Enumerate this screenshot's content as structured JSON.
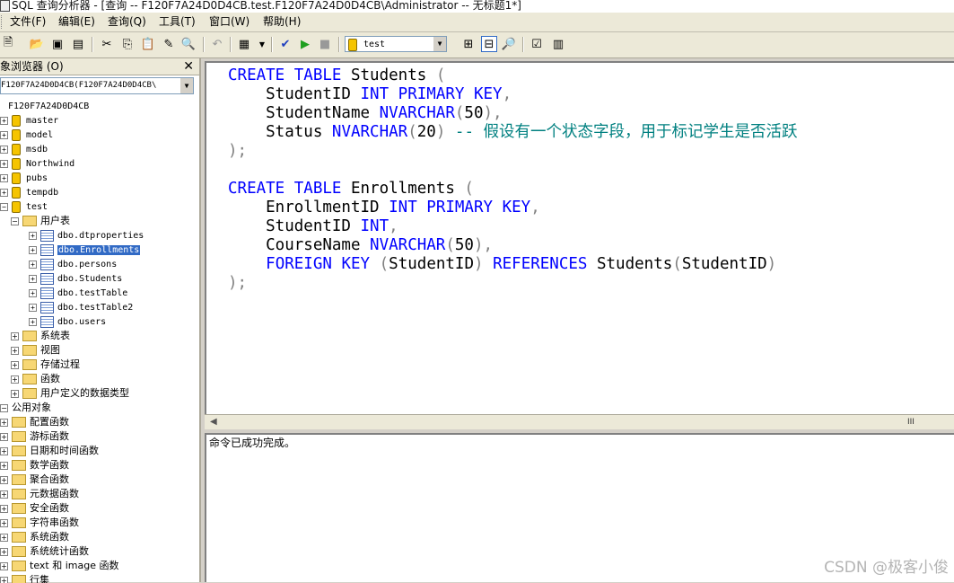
{
  "window": {
    "title": "SQL 查询分析器 - [查询 -- F120F7A24D0D4CB.test.F120F7A24D0D4CB\\Administrator -- 无标题1*]"
  },
  "menu": [
    "文件(F)",
    "编辑(E)",
    "查询(Q)",
    "工具(T)",
    "窗口(W)",
    "帮助(H)"
  ],
  "toolbar": {
    "database": "test"
  },
  "object_browser": {
    "title": "对象浏览器 (O)",
    "title_visible": "象浏览器 (O)",
    "server": "F120F7A24D0D4CB(F120F7A24D0D4CB\\",
    "tree": {
      "root": "F120F7A24D0D4CB",
      "databases": [
        "master",
        "model",
        "msdb",
        "Northwind",
        "pubs",
        "tempdb",
        "test"
      ],
      "user_tables_folder": "用户表",
      "user_tables": [
        "dbo.dtproperties",
        "dbo.Enrollments",
        "dbo.persons",
        "dbo.Students",
        "dbo.testTable",
        "dbo.testTable2",
        "dbo.users"
      ],
      "test_folders": [
        "系统表",
        "视图",
        "存储过程",
        "函数",
        "用户定义的数据类型"
      ],
      "common_objects": "公用对象",
      "common_folders": [
        "配置函数",
        "游标函数",
        "日期和时间函数",
        "数学函数",
        "聚合函数",
        "元数据函数",
        "安全函数",
        "字符串函数",
        "系统函数",
        "系统统计函数",
        "text 和 image 函数",
        "行集"
      ]
    }
  },
  "editor": {
    "lines": [
      [
        [
          "kw",
          "CREATE"
        ],
        [
          "pl",
          " "
        ],
        [
          "kw",
          "TABLE"
        ],
        [
          "pl",
          " Students "
        ],
        [
          "op",
          "("
        ]
      ],
      [
        [
          "pl",
          "    StudentID "
        ],
        [
          "kw",
          "INT"
        ],
        [
          "pl",
          " "
        ],
        [
          "kw",
          "PRIMARY"
        ],
        [
          "pl",
          " "
        ],
        [
          "kw",
          "KEY"
        ],
        [
          "op",
          ","
        ]
      ],
      [
        [
          "pl",
          "    StudentName "
        ],
        [
          "kw",
          "NVARCHAR"
        ],
        [
          "op",
          "("
        ],
        [
          "pl",
          "50"
        ],
        [
          "op",
          "),"
        ]
      ],
      [
        [
          "pl",
          "    Status "
        ],
        [
          "kw",
          "NVARCHAR"
        ],
        [
          "op",
          "("
        ],
        [
          "pl",
          "20"
        ],
        [
          "op",
          ")"
        ],
        [
          "pl",
          " "
        ],
        [
          "cm",
          "-- 假设有一个状态字段，用于标记学生是否活跃"
        ]
      ],
      [
        [
          "op",
          ");"
        ]
      ],
      [
        [
          "pl",
          ""
        ]
      ],
      [
        [
          "kw",
          "CREATE"
        ],
        [
          "pl",
          " "
        ],
        [
          "kw",
          "TABLE"
        ],
        [
          "pl",
          " Enrollments "
        ],
        [
          "op",
          "("
        ]
      ],
      [
        [
          "pl",
          "    EnrollmentID "
        ],
        [
          "kw",
          "INT"
        ],
        [
          "pl",
          " "
        ],
        [
          "kw",
          "PRIMARY"
        ],
        [
          "pl",
          " "
        ],
        [
          "kw",
          "KEY"
        ],
        [
          "op",
          ","
        ]
      ],
      [
        [
          "pl",
          "    StudentID "
        ],
        [
          "kw",
          "INT"
        ],
        [
          "op",
          ","
        ]
      ],
      [
        [
          "pl",
          "    CourseName "
        ],
        [
          "kw",
          "NVARCHAR"
        ],
        [
          "op",
          "("
        ],
        [
          "pl",
          "50"
        ],
        [
          "op",
          "),"
        ]
      ],
      [
        [
          "pl",
          "    "
        ],
        [
          "kw",
          "FOREIGN"
        ],
        [
          "pl",
          " "
        ],
        [
          "kw",
          "KEY"
        ],
        [
          "pl",
          " "
        ],
        [
          "op",
          "("
        ],
        [
          "pl",
          "StudentID"
        ],
        [
          "op",
          ")"
        ],
        [
          "pl",
          " "
        ],
        [
          "kw",
          "REFERENCES"
        ],
        [
          "pl",
          " Students"
        ],
        [
          "op",
          "("
        ],
        [
          "pl",
          "StudentID"
        ],
        [
          "op",
          ")"
        ]
      ],
      [
        [
          "op",
          ");"
        ]
      ]
    ]
  },
  "results": {
    "message": "命令已成功完成。"
  },
  "watermark": "CSDN @极客小俊",
  "colors": {
    "keyword": "#0000ff",
    "operator": "#808080",
    "comment": "#008080",
    "selection": "#316ac5"
  }
}
